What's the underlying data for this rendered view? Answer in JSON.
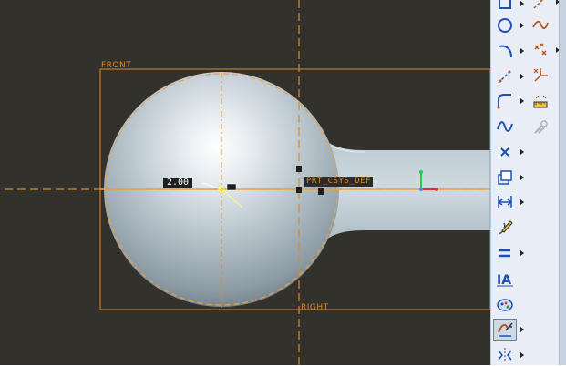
{
  "viewport": {
    "background": "#33312c",
    "datum_color": "#d98b2b",
    "labels": {
      "front_plane": "FRONT",
      "right_plane": "RIGHT",
      "csys": "PRT_CSYS_DEF",
      "dimension": "2.00"
    }
  },
  "toolbar": {
    "sketch_tools": [
      {
        "icon": "rectangle-icon",
        "has_flyout": true
      },
      {
        "icon": "circle-icon",
        "has_flyout": true
      },
      {
        "icon": "arc-icon",
        "has_flyout": true
      },
      {
        "icon": "centerline-icon",
        "has_flyout": true
      },
      {
        "icon": "fillet-icon",
        "has_flyout": true
      },
      {
        "icon": "spline-icon",
        "has_flyout": false
      },
      {
        "icon": "point-icon",
        "has_flyout": true
      },
      {
        "icon": "offset-edge-icon",
        "has_flyout": true
      },
      {
        "icon": "dimension-icon",
        "has_flyout": true
      },
      {
        "icon": "modify-icon",
        "has_flyout": false
      },
      {
        "icon": "constraint-icon",
        "has_flyout": true
      },
      {
        "icon": "text-icon",
        "has_flyout": false
      },
      {
        "icon": "palette-icon",
        "has_flyout": false
      },
      {
        "icon": "trim-icon",
        "has_flyout": true,
        "active": true
      },
      {
        "icon": "mirror-icon",
        "has_flyout": true
      }
    ],
    "datum_tools": [
      {
        "icon": "datum-axis-icon",
        "has_flyout": true
      },
      {
        "icon": "datum-curve-icon",
        "has_flyout": false
      },
      {
        "icon": "datum-point-icon",
        "has_flyout": true
      },
      {
        "icon": "datum-csys-icon",
        "has_flyout": false
      },
      {
        "icon": "analysis-icon",
        "has_flyout": false
      },
      {
        "icon": "insert-feature-icon",
        "has_flyout": false
      }
    ]
  }
}
